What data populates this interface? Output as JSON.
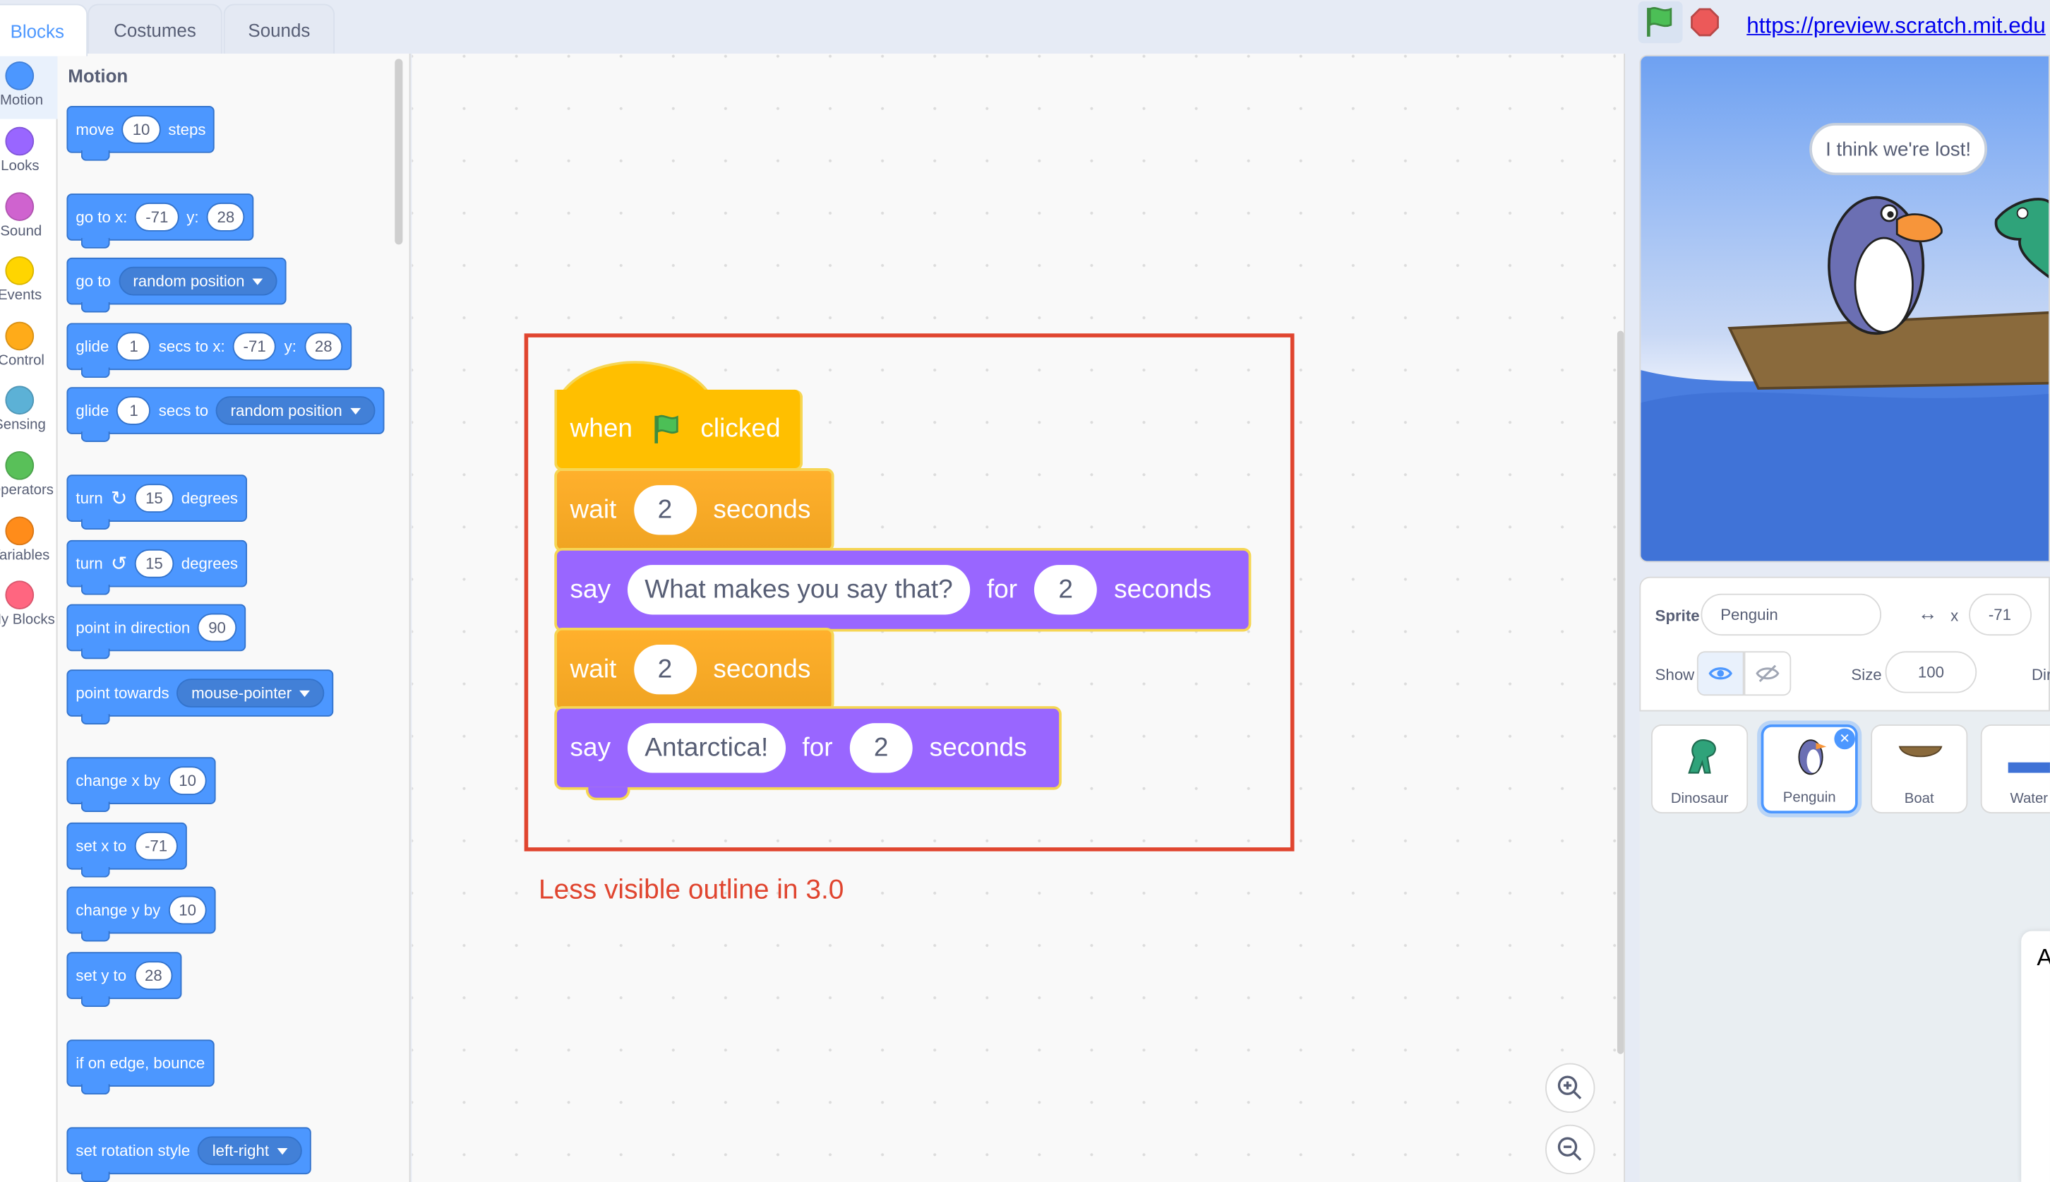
{
  "tabs": {
    "blocks": "Blocks",
    "costumes": "Costumes",
    "sounds": "Sounds"
  },
  "categories": [
    {
      "label": "Motion",
      "color": "#4c97ff"
    },
    {
      "label": "Looks",
      "color": "#9966ff"
    },
    {
      "label": "Sound",
      "color": "#cf63cf"
    },
    {
      "label": "Events",
      "color": "#ffd500"
    },
    {
      "label": "Control",
      "color": "#ffab19"
    },
    {
      "label": "Sensing",
      "color": "#5cb1d6"
    },
    {
      "label": "Operators",
      "color": "#59c059"
    },
    {
      "label": "Variables",
      "color": "#ff8c1a"
    },
    {
      "label": "My Blocks",
      "color": "#ff6680"
    }
  ],
  "palette": {
    "heading": "Motion",
    "move": {
      "a": "move",
      "n": "10",
      "b": "steps"
    },
    "gotoxy": {
      "a": "go to x:",
      "x": "-71",
      "b": "y:",
      "y": "28"
    },
    "goto": {
      "a": "go to",
      "dd": "random position"
    },
    "glidexy": {
      "a": "glide",
      "n": "1",
      "b": "secs to x:",
      "x": "-71",
      "c": "y:",
      "y": "28"
    },
    "glideto": {
      "a": "glide",
      "n": "1",
      "b": "secs to",
      "dd": "random position"
    },
    "turnr": {
      "a": "turn",
      "n": "15",
      "b": "degrees"
    },
    "turnl": {
      "a": "turn",
      "n": "15",
      "b": "degrees"
    },
    "pointdir": {
      "a": "point in direction",
      "n": "90"
    },
    "pointtow": {
      "a": "point towards",
      "dd": "mouse-pointer"
    },
    "changex": {
      "a": "change x by",
      "n": "10"
    },
    "setx": {
      "a": "set x to",
      "n": "-71"
    },
    "changey": {
      "a": "change y by",
      "n": "10"
    },
    "sety": {
      "a": "set y to",
      "n": "28"
    },
    "bounce": {
      "a": "if on edge, bounce"
    },
    "rotstyle": {
      "a": "set rotation style",
      "dd": "left-right"
    }
  },
  "script": {
    "hat": {
      "a": "when",
      "b": "clicked"
    },
    "wait1": {
      "a": "wait",
      "n": "2",
      "b": "seconds"
    },
    "say1": {
      "a": "say",
      "msg": "What makes you say that?",
      "b": "for",
      "n": "2",
      "c": "seconds"
    },
    "wait2": {
      "a": "wait",
      "n": "2",
      "b": "seconds"
    },
    "say2": {
      "a": "say",
      "msg": "Antarctica!",
      "b": "for",
      "n": "2",
      "c": "seconds"
    }
  },
  "annotation": "Less visible outline in 3.0",
  "url": "https://preview.scratch.mit.edu",
  "stage": {
    "bubble": "I think we're lost!"
  },
  "sprite_info": {
    "sprite_label": "Sprite",
    "sprite_name": "Penguin",
    "x_label": "x",
    "x_value": "-71",
    "show_label": "Show",
    "size_label": "Size",
    "size_value": "100",
    "dir_label": "Dir"
  },
  "sprites": [
    {
      "name": "Dinosaur"
    },
    {
      "name": "Penguin"
    },
    {
      "name": "Boat"
    },
    {
      "name": "Water"
    }
  ],
  "right_panel_letter": "A"
}
